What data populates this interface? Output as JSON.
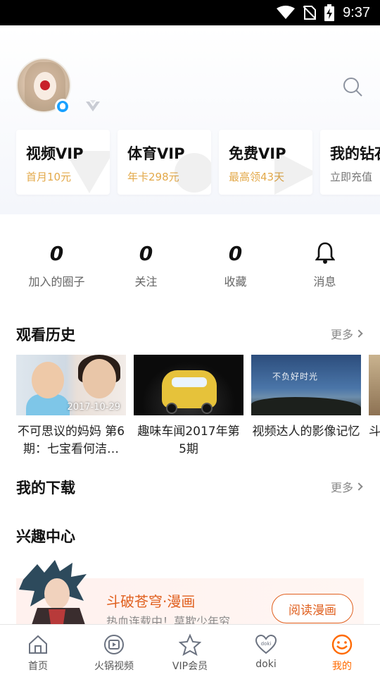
{
  "status_bar": {
    "time": "9:37"
  },
  "profile": {
    "badge_icon": "profile-badge-icon",
    "vip_icon": "vip-level-icon"
  },
  "vip_cards": [
    {
      "title": "视频VIP",
      "subtitle": "首月10元",
      "subtitle_color": "#e3a94a"
    },
    {
      "title": "体育VIP",
      "subtitle": "年卡298元",
      "subtitle_color": "#e3a94a"
    },
    {
      "title": "免费VIP",
      "subtitle": "最高领43天",
      "subtitle_color": "#e3a94a"
    },
    {
      "title": "我的钻石",
      "subtitle": "立即充值",
      "subtitle_color": "#777777"
    }
  ],
  "stats": [
    {
      "value": "0",
      "label": "加入的圈子"
    },
    {
      "value": "0",
      "label": "关注"
    },
    {
      "value": "0",
      "label": "收藏"
    },
    {
      "icon": "bell-icon",
      "label": "消息"
    }
  ],
  "history": {
    "title": "观看历史",
    "more": "更多",
    "items": [
      {
        "title": "不可思议的妈妈 第6期：七宝看何洁…",
        "date": "2017-10-29"
      },
      {
        "title": "趣味车闻2017年第5期"
      },
      {
        "title": "视频达人的影像记忆",
        "thumb_text": "不负好时光"
      },
      {
        "title": "斗"
      }
    ]
  },
  "downloads": {
    "title": "我的下载",
    "more": "更多"
  },
  "interest": {
    "title": "兴趣中心",
    "banner": {
      "title": "斗破苍穹·漫画",
      "subtitle": "热血连载中！莫欺少年穷",
      "button": "阅读漫画"
    }
  },
  "tabbar": {
    "active_color": "#ff6a00",
    "items": [
      {
        "label": "首页",
        "icon": "home-icon"
      },
      {
        "label": "火锅视频",
        "icon": "video-icon"
      },
      {
        "label": "VIP会员",
        "icon": "vip-star-icon"
      },
      {
        "label": "doki",
        "icon": "doki-heart-icon"
      },
      {
        "label": "我的",
        "icon": "smile-icon",
        "active": true
      }
    ]
  }
}
